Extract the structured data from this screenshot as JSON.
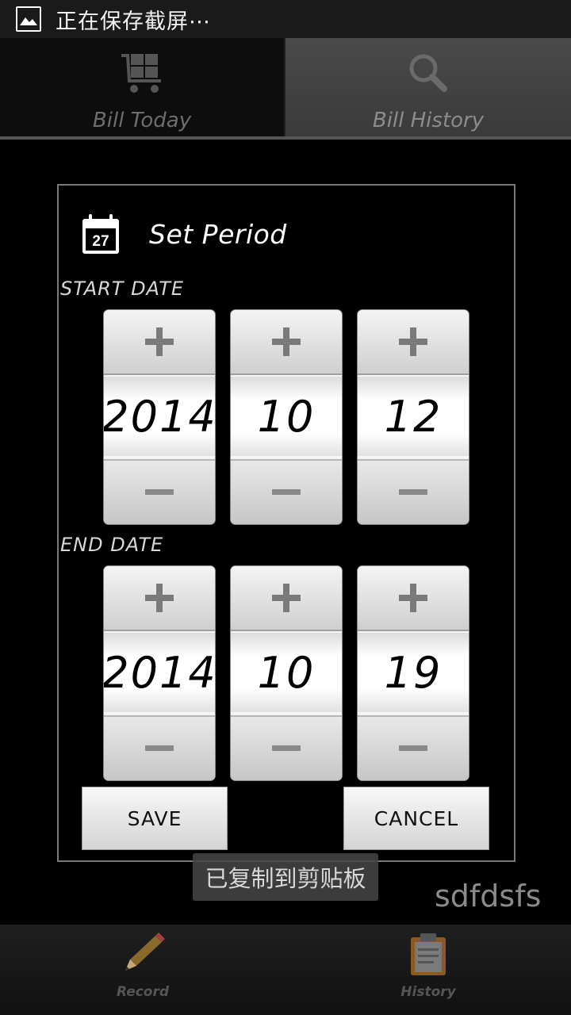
{
  "status_bar": {
    "icon": "image-icon",
    "text": "正在保存截屏⋯"
  },
  "tabs": [
    {
      "label": "Bill Today",
      "icon": "cart-icon",
      "active": true
    },
    {
      "label": "Bill History",
      "icon": "search-icon",
      "active": false
    }
  ],
  "dialog": {
    "title": "Set Period",
    "icon": "calendar-icon",
    "calendar_day": "27",
    "start_label": "START DATE",
    "end_label": "END DATE",
    "start": {
      "year": "2014",
      "month": "10",
      "day": "12"
    },
    "end": {
      "year": "2014",
      "month": "10",
      "day": "19"
    },
    "save_label": "SAVE",
    "cancel_label": "CANCEL"
  },
  "toast": "已复制到剪贴板",
  "watermark": "sdfdsfs",
  "bottom_nav": [
    {
      "label": "Record",
      "icon": "pencil-icon"
    },
    {
      "label": "History",
      "icon": "clipboard-icon"
    }
  ],
  "colors": {
    "background": "#000000",
    "tab_inactive": "#3f3f3f",
    "dialog_border": "#7a7a7a"
  }
}
